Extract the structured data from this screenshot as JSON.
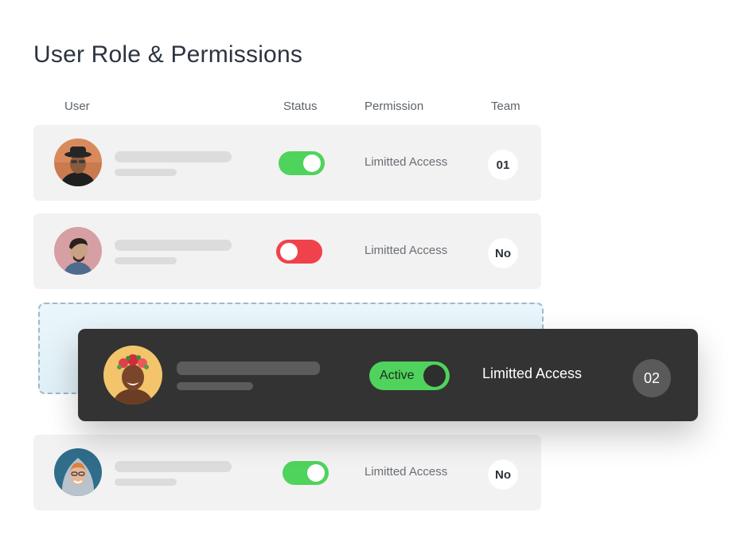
{
  "page": {
    "title": "User Role & Permissions"
  },
  "columns": {
    "user": "User",
    "status": "Status",
    "permission": "Permission",
    "team": "Team"
  },
  "rows": [
    {
      "status": "on",
      "status_color": "#4fd35c",
      "permission": "Limitted Access",
      "team": "01",
      "avatar_icon": "avatar-man-hat-sunglasses"
    },
    {
      "status": "off",
      "status_color": "#f0424a",
      "permission": "Limitted Access",
      "team": "No",
      "avatar_icon": "avatar-man-profile"
    },
    {
      "status": "on",
      "status_color": "#4fd35c",
      "permission": "Limitted Access",
      "team": "No",
      "avatar_icon": "avatar-woman-hood"
    }
  ],
  "dragging_row": {
    "status_label": "Active",
    "status_color": "#4fd35c",
    "permission": "Limitted Access",
    "team": "02",
    "avatar_icon": "avatar-woman-flower-crown"
  }
}
